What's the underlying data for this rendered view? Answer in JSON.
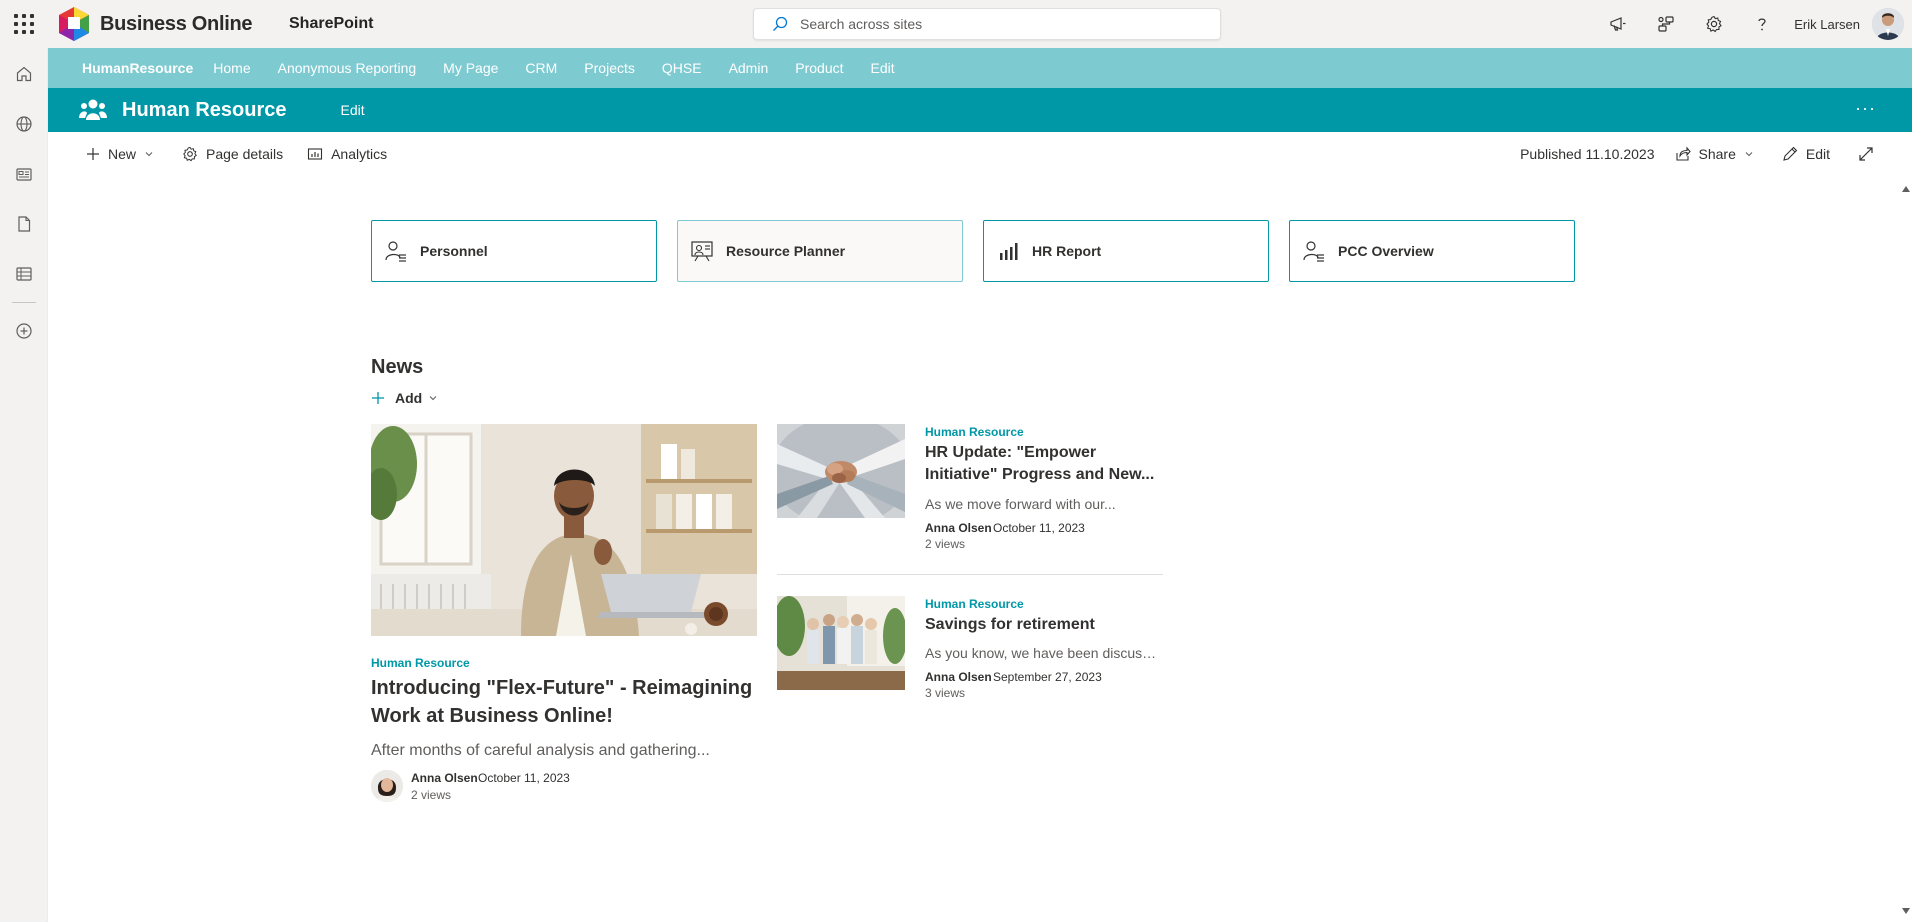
{
  "suite": {
    "brand": "Business Online",
    "app_name": "SharePoint",
    "search_placeholder": "Search across sites",
    "user_name": "Erik Larsen"
  },
  "hubnav": {
    "title": "HumanResource",
    "links": [
      "Home",
      "Anonymous Reporting",
      "My Page",
      "CRM",
      "Projects",
      "QHSE",
      "Admin",
      "Product",
      "Edit"
    ]
  },
  "site": {
    "title": "Human Resource",
    "edit_label": "Edit",
    "more_label": "···"
  },
  "commandbar": {
    "new_label": "New",
    "page_details_label": "Page details",
    "analytics_label": "Analytics",
    "published": "Published 11.10.2023",
    "share_label": "Share",
    "edit_label": "Edit"
  },
  "quicklinks": [
    {
      "label": "Personnel",
      "icon": "people-list-icon"
    },
    {
      "label": "Resource Planner",
      "icon": "planner-icon"
    },
    {
      "label": "HR Report",
      "icon": "bar-chart-icon"
    },
    {
      "label": "PCC Overview",
      "icon": "people-list-icon"
    }
  ],
  "news": {
    "title": "News",
    "add_label": "Add",
    "hero": {
      "category": "Human Resource",
      "title": "Introducing \"Flex-Future\" - Reimagining Work at Business Online!",
      "description": "After months of careful analysis and gathering...",
      "author": "Anna Olsen",
      "date": "October 11, 2023",
      "views": "2 views"
    },
    "items": [
      {
        "category": "Human Resource",
        "title": "HR Update: \"Empower Initiative\" Progress and New...",
        "description": "As we move forward with our...",
        "author": "Anna Olsen",
        "date": "October 11, 2023",
        "views": "2 views"
      },
      {
        "category": "Human Resource",
        "title": "Savings for retirement",
        "description": "As you know, we have been discussi...",
        "author": "Anna Olsen",
        "date": "September 27, 2023",
        "views": "3 views"
      }
    ]
  },
  "colors": {
    "hub_nav": "#7ecad1",
    "site_header": "#0097a7",
    "accent": "#0097a7"
  }
}
